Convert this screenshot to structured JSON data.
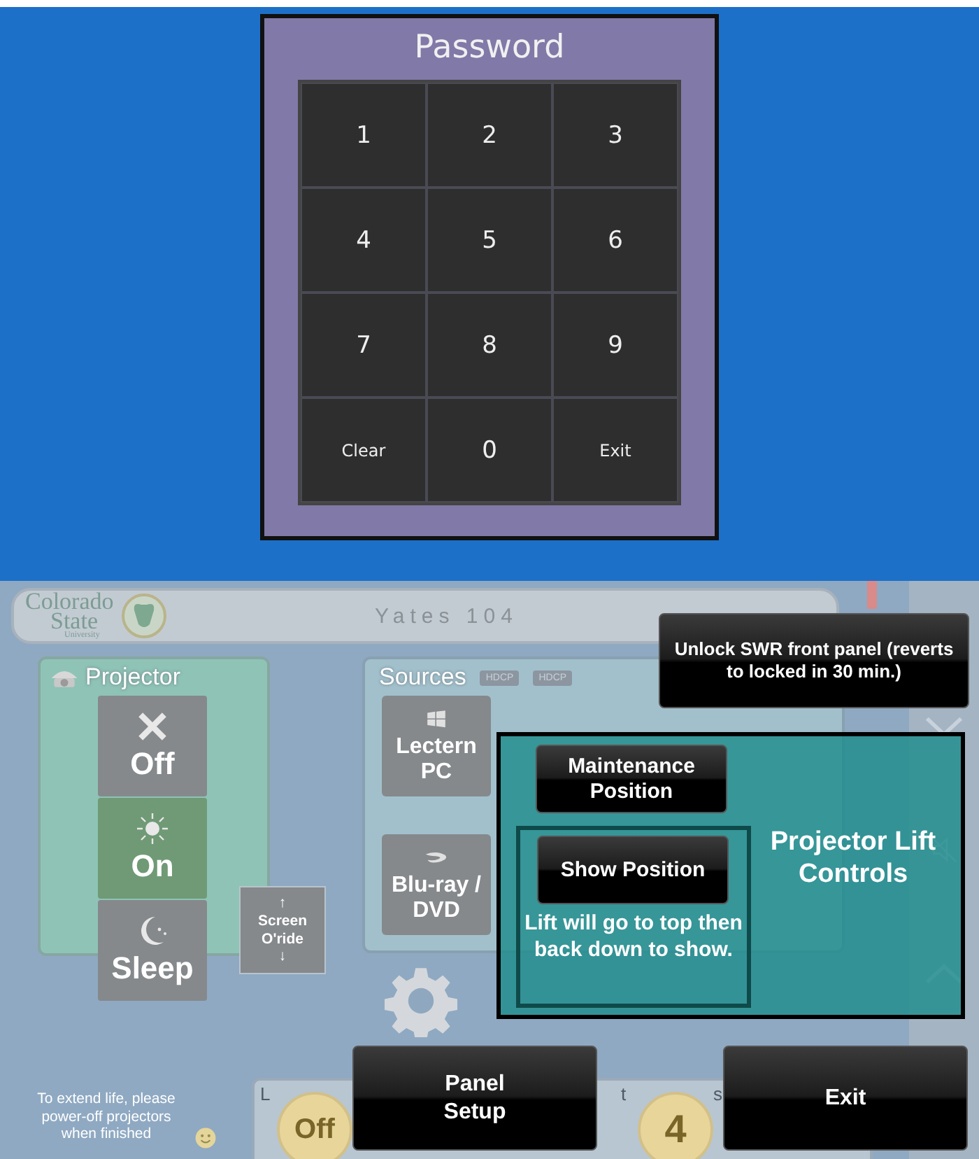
{
  "password_dialog": {
    "title": "Password",
    "keys": [
      "1",
      "2",
      "3",
      "4",
      "5",
      "6",
      "7",
      "8",
      "9",
      "Clear",
      "0",
      "Exit"
    ]
  },
  "panel": {
    "logo": {
      "line_1": "Colorado",
      "line_2": "State",
      "line_3": "University"
    },
    "room": "Yates 104",
    "projector": {
      "title": "Projector",
      "buttons": [
        {
          "kind": "off",
          "label": "Off",
          "selected": false
        },
        {
          "kind": "on",
          "label": "On",
          "selected": true
        },
        {
          "kind": "sleep",
          "label": "Sleep",
          "selected": false
        }
      ]
    },
    "screen_override": {
      "up": "↑",
      "label": "Screen O'ride",
      "down": "↓"
    },
    "sources": {
      "title": "Sources",
      "badges": [
        "HDCP",
        "HDCP"
      ],
      "tiles": [
        {
          "kind": "windows",
          "label": "Lectern PC"
        },
        {
          "kind": "bluray",
          "label": "Blu-ray / DVD"
        }
      ]
    },
    "notice": "To extend life, please power-off projectors when finished",
    "bottom_bar": {
      "letters": [
        "L",
        "t",
        "s"
      ],
      "circles": [
        "Off",
        "4"
      ]
    }
  },
  "overlay": {
    "unlock_button": "Unlock SWR front panel (reverts to locked in 30 min.)",
    "lift_controls": {
      "title": "Projector Lift Controls",
      "maintenance_button": "Maintenance Position",
      "show_button": "Show Position",
      "show_note": "Lift will go to top then back down to show."
    },
    "panel_setup_button": "Panel Setup",
    "exit_button": "Exit"
  }
}
